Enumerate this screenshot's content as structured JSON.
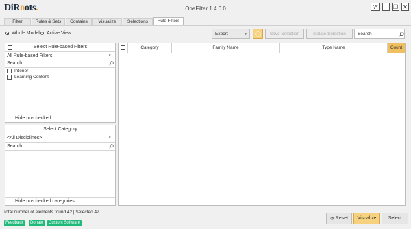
{
  "app": {
    "logo_text": "DiRoots",
    "title": "OneFilter 1.4.0.0",
    "help_label": "?",
    "minimize_label": "_",
    "restore_label": "❐",
    "close_label": "✕"
  },
  "tabs": [
    {
      "label": "Filter"
    },
    {
      "label": "Rules & Sets"
    },
    {
      "label": "Contains"
    },
    {
      "label": "Visualize"
    },
    {
      "label": "Selections"
    },
    {
      "label": "Rule Filters"
    }
  ],
  "scope": {
    "whole_model": "Whole Model",
    "active_view": "Active View",
    "selected": "whole_model"
  },
  "toolbar": {
    "export_label": "Export",
    "save_selection": "Save Selection",
    "isolate_selection": "Isolate Selection",
    "search_placeholder": "Search"
  },
  "rules_panel": {
    "header": "Select Rule-based Filters",
    "dropdown_value": "All Rule-based Filters",
    "search_placeholder": "Search",
    "items": [
      {
        "label": "Interior"
      },
      {
        "label": "Learning Content"
      }
    ],
    "hide_unchecked": "Hide un-checked"
  },
  "category_panel": {
    "header": "Select Category",
    "dropdown_value": "<All Disciplines>",
    "search_placeholder": "Search",
    "hide_unchecked": "Hide un-checked categories"
  },
  "grid": {
    "columns": [
      "Category",
      "Family Name",
      "Type Name",
      "Count"
    ]
  },
  "status": {
    "text": "Total number of elements found 42 | Selected 42"
  },
  "footer": {
    "feedback": "Feedback",
    "donate": "Donate",
    "custom_software": "Custom Software",
    "reset": "Reset",
    "visualize": "Visualize",
    "select": "Select"
  },
  "colors": {
    "accent_orange": "#f6d27e",
    "green": "#1fb97a",
    "logo_accent": "#e8a33a"
  }
}
